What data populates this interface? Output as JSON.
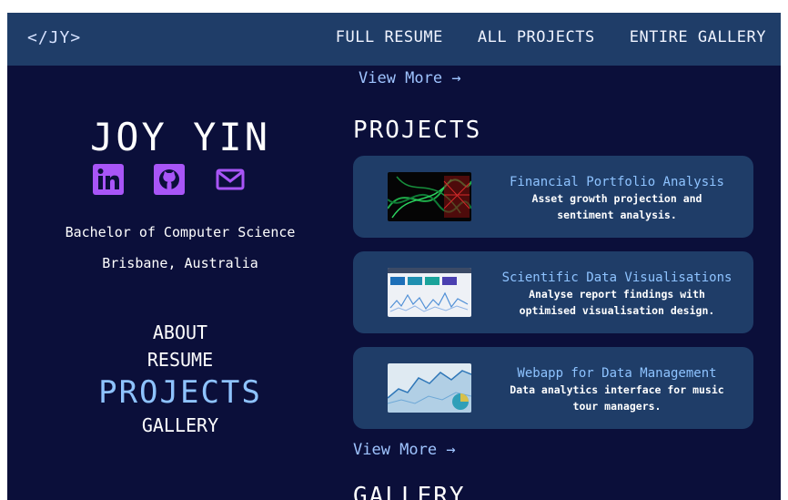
{
  "nav": {
    "logo": "</JY>",
    "links": [
      "FULL RESUME",
      "ALL PROJECTS",
      "ENTIRE GALLERY"
    ]
  },
  "top_view_more": "View More →",
  "profile": {
    "name": "JOY YIN",
    "degree": "Bachelor of Computer Science",
    "location": "Brisbane, Australia",
    "socials": [
      "linkedin-icon",
      "github-icon",
      "mail-icon"
    ]
  },
  "side_nav": [
    "ABOUT",
    "RESUME",
    "PROJECTS",
    "GALLERY"
  ],
  "projects": {
    "title": "PROJECTS",
    "items": [
      {
        "title": "Financial Portfolio Analysis",
        "line1": "Asset growth projection and",
        "line2": "sentiment analysis."
      },
      {
        "title": "Scientific Data Visualisations",
        "line1": "Analyse report findings with",
        "line2": "optimised visualisation design."
      },
      {
        "title": "Webapp for Data Management",
        "line1": "Data analytics interface for music",
        "line2": "tour managers."
      }
    ],
    "view_more": "View More →"
  },
  "gallery": {
    "title": "GALLERY"
  },
  "colors": {
    "background": "#0b0f3a",
    "navbar": "#1f3d68",
    "accent": "#8ec3ff",
    "icon": "#a855f7"
  }
}
